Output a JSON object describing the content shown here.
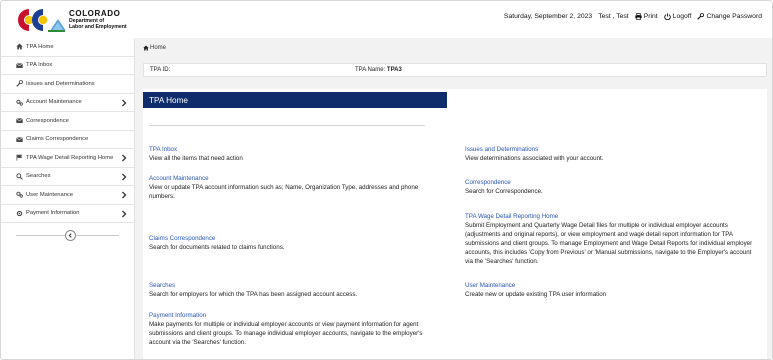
{
  "header": {
    "logo": {
      "title": "COLORADO",
      "line1": "Department of",
      "line2": "Labor and Employment"
    },
    "date": "Saturday, September 2, 2023",
    "user": "Test , Test",
    "print_label": "Print",
    "logoff_label": "Logoff",
    "change_password_label": "Change Password"
  },
  "sidebar": {
    "items": [
      {
        "label": "TPA Home",
        "icon": "home-icon",
        "chevron": false
      },
      {
        "label": "TPA Inbox",
        "icon": "envelope-icon",
        "chevron": false
      },
      {
        "label": "Issues and Determinations",
        "icon": "wrench-icon",
        "chevron": false
      },
      {
        "label": "Account Maintenance",
        "icon": "gears-icon",
        "chevron": true
      },
      {
        "label": "Correspondence",
        "icon": "envelope-icon",
        "chevron": false
      },
      {
        "label": "Claims Correspondence",
        "icon": "envelope-icon",
        "chevron": false
      },
      {
        "label": "TPA Wage Detail Reporting Home",
        "icon": "flag-icon",
        "chevron": true
      },
      {
        "label": "Searches",
        "icon": "search-icon",
        "chevron": true
      },
      {
        "label": "User Maintenance",
        "icon": "gears-icon",
        "chevron": true
      },
      {
        "label": "Payment Information",
        "icon": "gear-icon",
        "chevron": true
      }
    ]
  },
  "breadcrumb": {
    "label": "Home"
  },
  "tpa": {
    "id_label": "TPA ID:",
    "id_value": "",
    "name_label": "TPA Name:",
    "name_value": "TPA3"
  },
  "content": {
    "title": "TPA Home",
    "left": [
      {
        "link": "TPA Inbox",
        "desc": "View all the items that need action"
      },
      {
        "link": "Account Maintenance",
        "desc": "View or update TPA account information such as; Name, Organization Type, addresses and phone numbers."
      },
      {
        "link": "Claims Correspondence",
        "desc": "Search for documents related to claims functions."
      },
      {
        "link": "Searches",
        "desc": "Search for employers for which the TPA has been assigned account access."
      },
      {
        "link": "Payment Information",
        "desc": "Make payments for multiple or individual employer accounts or view payment information for agent submissions and client groups. To manage individual employer accounts, navigate to the employer's account via the 'Searches' function."
      }
    ],
    "right": [
      {
        "link": "Issues and Determinations",
        "desc": "View determinations associated with your account."
      },
      {
        "link": "Correspondence",
        "desc": "Search for Correspondence."
      },
      {
        "link": "TPA Wage Detail Reporting Home",
        "desc": "Submit Employment and Quarterly Wage Detail files for multiple or individual employer accounts (adjustments and original reports), or view employment and wage detail report information for TPA submissions and client groups. To manage Employment and Wage Detail Reports for individual employer accounts, this includes 'Copy from Previous' or 'Manual submissions, navigate to the Employer's account via the 'Searches' function."
      },
      {
        "link": "User Maintenance",
        "desc": "Create new or update existing TPA user information"
      }
    ]
  },
  "colors": {
    "banner": "#0f2d6b",
    "link": "#2a56b8",
    "main_bg": "#f2f2f2"
  }
}
